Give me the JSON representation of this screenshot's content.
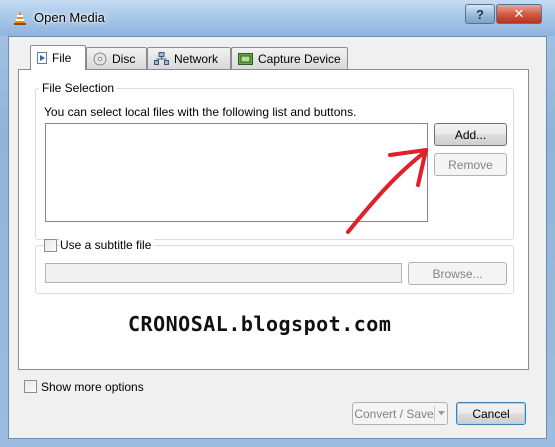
{
  "window": {
    "title": "Open Media",
    "help_label": "?",
    "close_label": "✕"
  },
  "tabs": [
    {
      "label": "File",
      "icon": "file-play-icon",
      "active": true
    },
    {
      "label": "Disc",
      "icon": "disc-icon",
      "active": false
    },
    {
      "label": "Network",
      "icon": "network-icon",
      "active": false
    },
    {
      "label": "Capture Device",
      "icon": "capture-device-icon",
      "active": false
    }
  ],
  "file_selection": {
    "legend": "File Selection",
    "hint": "You can select local files with the following list and buttons.",
    "add_label": "Add...",
    "remove_label": "Remove"
  },
  "subtitle": {
    "checkbox_label": "Use a subtitle file",
    "checked": false,
    "browse_label": "Browse..."
  },
  "watermark": "CRONOSAL.blogspot.com",
  "footer": {
    "show_more_label": "Show more options",
    "show_more_checked": false,
    "convert_label": "Convert / Save",
    "cancel_label": "Cancel"
  },
  "colors": {
    "annotation_arrow": "#e0202a",
    "vlc_cone": "#f08a00"
  }
}
